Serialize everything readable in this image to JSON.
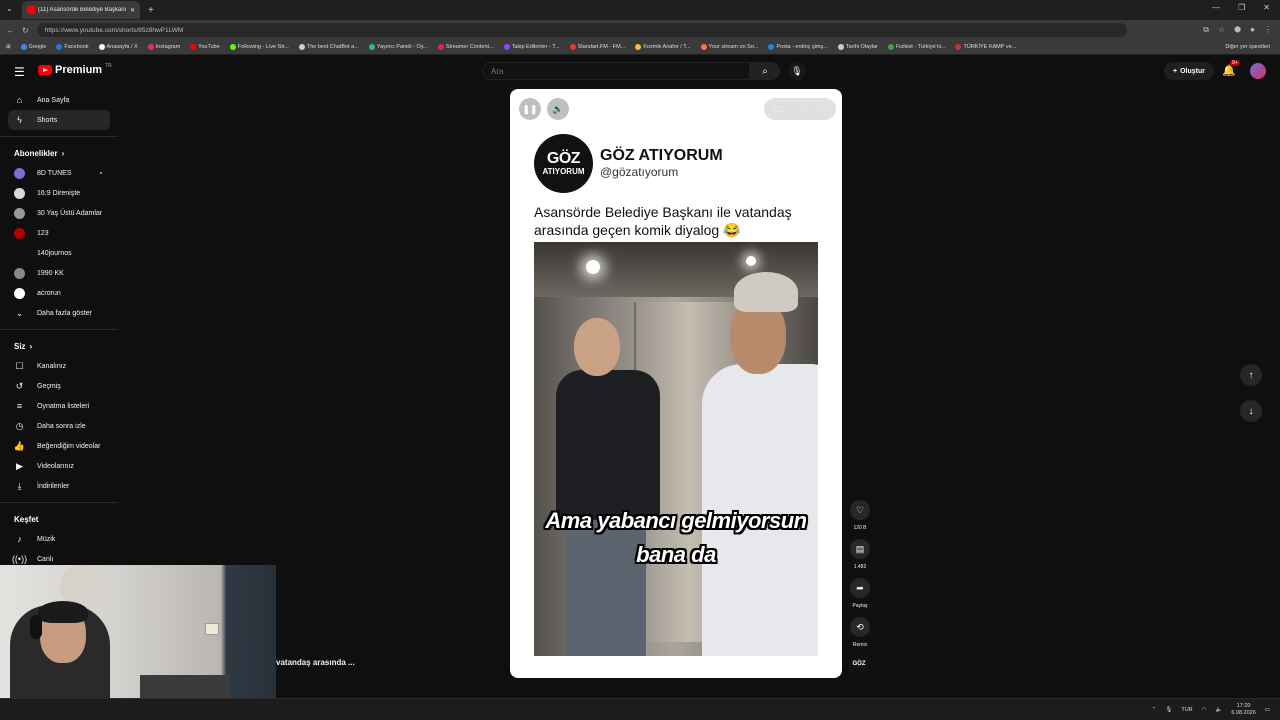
{
  "browser": {
    "tab_title": "(11) Asansörde Belediye Başkanı",
    "url": "https://www.youtube.com/shorts/85z8hwP1LWM",
    "bookmarks": [
      {
        "label": "Google",
        "color": "#4285f4"
      },
      {
        "label": "Facebook",
        "color": "#1877f2"
      },
      {
        "label": "Anasayfa / X",
        "color": "#ffffff"
      },
      {
        "label": "Instagram",
        "color": "#e1306c"
      },
      {
        "label": "YouTube",
        "color": "#ff0000"
      },
      {
        "label": "Following - Live Str...",
        "color": "#53fc18"
      },
      {
        "label": "The best ChatBot a...",
        "color": "#cccccc"
      },
      {
        "label": "Yayıncı Paneli - Oy...",
        "color": "#29b6a0"
      },
      {
        "label": "Streamer Content...",
        "color": "#e91e63"
      },
      {
        "label": "Takip Edilenler - T...",
        "color": "#9146ff"
      },
      {
        "label": "Standart.FM - FM...",
        "color": "#e53935"
      },
      {
        "label": "Kozmik Anafor / T...",
        "color": "#fbc02d"
      },
      {
        "label": "Your stream on So...",
        "color": "#ff7043"
      },
      {
        "label": "Posta - erdinç şimş...",
        "color": "#1e88e5"
      },
      {
        "label": "Tarihi Olaylar",
        "color": "#cccccc"
      },
      {
        "label": "Fizikist - Türkiye'ni...",
        "color": "#43a047"
      },
      {
        "label": "TÜRKİYE KAMP ve...",
        "color": "#d32f2f"
      }
    ],
    "all_bookmarks": "Diğer yer işaretleri"
  },
  "header": {
    "logo_text": "Premium",
    "logo_region": "TR",
    "search_placeholder": "Ara",
    "create_label": "Oluştur",
    "notif_count": "9+"
  },
  "sidebar": {
    "main": [
      {
        "label": "Ana Sayfa",
        "icon": "home-icon",
        "glyph": "⌂"
      },
      {
        "label": "Shorts",
        "icon": "shorts-icon",
        "glyph": "ϟ"
      }
    ],
    "subs_title": "Abonelikler",
    "subs": [
      {
        "label": "8D TUNES",
        "color": "#7b6fd6",
        "live": true
      },
      {
        "label": "16:9 Direnişte",
        "color": "#d9d9d9",
        "live": false
      },
      {
        "label": "30 Yaş Üstü Adamlar",
        "color": "#9a9a9a",
        "live": false
      },
      {
        "label": "123",
        "color": "#b00000",
        "live": false
      },
      {
        "label": "140journos",
        "color": "#0f0f0f",
        "live": false
      },
      {
        "label": "1990 KK",
        "color": "#888888",
        "live": false
      },
      {
        "label": "acrorun",
        "color": "#ffffff",
        "live": false
      }
    ],
    "show_more": "Daha fazla göster",
    "you_title": "Siz",
    "you": [
      {
        "label": "Kanalınız",
        "icon": "channel-icon",
        "glyph": "☐"
      },
      {
        "label": "Geçmiş",
        "icon": "history-icon",
        "glyph": "↺"
      },
      {
        "label": "Oynatma listeleri",
        "icon": "playlists-icon",
        "glyph": "≡"
      },
      {
        "label": "Daha sonra izle",
        "icon": "watch-later-icon",
        "glyph": "◷"
      },
      {
        "label": "Beğendiğim videolar",
        "icon": "liked-icon",
        "glyph": "👍"
      },
      {
        "label": "Videolarınız",
        "icon": "your-videos-icon",
        "glyph": "▶"
      },
      {
        "label": "İndirilenler",
        "icon": "downloads-icon",
        "glyph": "⤓"
      }
    ],
    "explore_title": "Keşfet",
    "explore": [
      {
        "label": "Müzik",
        "icon": "music-icon",
        "glyph": "♪"
      },
      {
        "label": "Canlı",
        "icon": "live-icon",
        "glyph": "((•))"
      }
    ]
  },
  "short": {
    "account_name": "GÖZ ATIYORUM",
    "account_handle": "@gözatıyorum",
    "logo_line1": "GÖZ",
    "logo_line2": "ATIYORUM",
    "caption": "Asansörde Belediye Başkanı ile vatandaş arasında geçen komik diyalog 😂",
    "subtitle_line1": "Ama yabancı gelmiyorsun",
    "subtitle_line2": "bana da",
    "peek_title": "vatandaş arasında ..."
  },
  "actions": {
    "likes": "120 B",
    "comments": "1.482",
    "share": "Paylaş",
    "remix": "Remix",
    "channel_badge": "GÖZ"
  },
  "taskbar": {
    "lang": "TUR",
    "time": "17:20",
    "date": "6.08.2026"
  }
}
